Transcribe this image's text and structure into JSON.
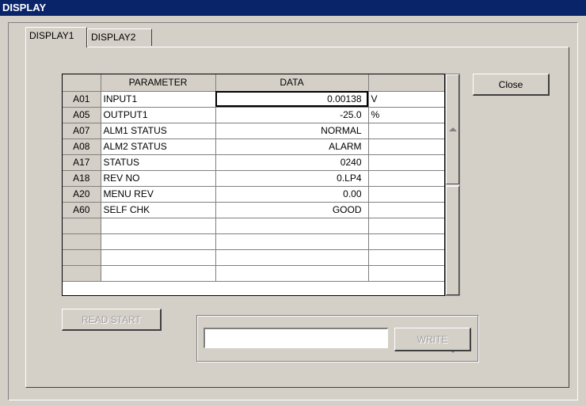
{
  "window": {
    "title": "DISPLAY"
  },
  "tabs": [
    {
      "label": "DISPLAY1",
      "active": true
    },
    {
      "label": "DISPLAY2",
      "active": false
    }
  ],
  "grid": {
    "columns": [
      "",
      "PARAMETER",
      "DATA",
      ""
    ],
    "rows": [
      {
        "id": "A01",
        "param": "INPUT1",
        "value": "0.00138",
        "unit": "V"
      },
      {
        "id": "A05",
        "param": "OUTPUT1",
        "value": "-25.0",
        "unit": "%"
      },
      {
        "id": "A07",
        "param": "ALM1 STATUS",
        "value": "NORMAL",
        "unit": ""
      },
      {
        "id": "A08",
        "param": "ALM2 STATUS",
        "value": "ALARM",
        "unit": ""
      },
      {
        "id": "A17",
        "param": "STATUS",
        "value": "0240",
        "unit": ""
      },
      {
        "id": "A18",
        "param": "REV NO",
        "value": "0.LP4",
        "unit": ""
      },
      {
        "id": "A20",
        "param": "MENU REV",
        "value": "0.00",
        "unit": ""
      },
      {
        "id": "A60",
        "param": "SELF CHK",
        "value": "GOOD",
        "unit": ""
      },
      {
        "id": "",
        "param": "",
        "value": "",
        "unit": ""
      },
      {
        "id": "",
        "param": "",
        "value": "",
        "unit": ""
      },
      {
        "id": "",
        "param": "",
        "value": "",
        "unit": ""
      },
      {
        "id": "",
        "param": "",
        "value": "",
        "unit": ""
      }
    ]
  },
  "buttons": {
    "close": "Close",
    "read_start": "READ START",
    "write": "WRITE"
  },
  "write_input": {
    "value": ""
  },
  "icons": {
    "scroll_up": "scroll-up-icon",
    "scroll_down": "scroll-down-icon"
  }
}
